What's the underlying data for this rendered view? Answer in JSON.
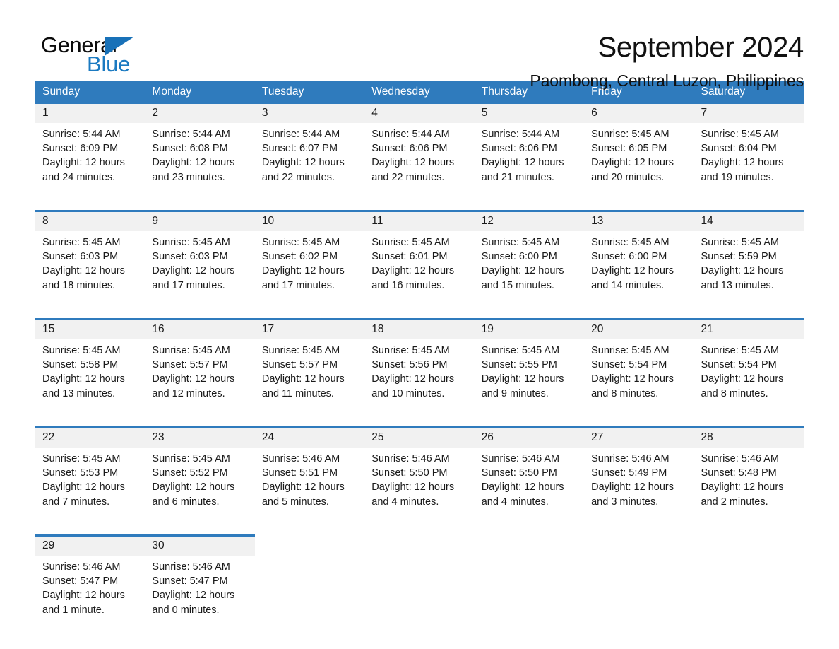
{
  "brand": {
    "name_part1": "General",
    "name_part2": "Blue",
    "triangle_color": "#1871b8",
    "blue_text_color": "#1b7ac1"
  },
  "header": {
    "month_title": "September 2024",
    "location": "Paombong, Central Luzon, Philippines"
  },
  "theme": {
    "header_blue": "#2f7bbd",
    "daynum_band": "#f1f1f1",
    "text": "#1a1a1a"
  },
  "weekday_headers": [
    "Sunday",
    "Monday",
    "Tuesday",
    "Wednesday",
    "Thursday",
    "Friday",
    "Saturday"
  ],
  "weeks": [
    [
      {
        "day": "1",
        "lines": [
          "Sunrise: 5:44 AM",
          "Sunset: 6:09 PM",
          "Daylight: 12 hours",
          "and 24 minutes."
        ]
      },
      {
        "day": "2",
        "lines": [
          "Sunrise: 5:44 AM",
          "Sunset: 6:08 PM",
          "Daylight: 12 hours",
          "and 23 minutes."
        ]
      },
      {
        "day": "3",
        "lines": [
          "Sunrise: 5:44 AM",
          "Sunset: 6:07 PM",
          "Daylight: 12 hours",
          "and 22 minutes."
        ]
      },
      {
        "day": "4",
        "lines": [
          "Sunrise: 5:44 AM",
          "Sunset: 6:06 PM",
          "Daylight: 12 hours",
          "and 22 minutes."
        ]
      },
      {
        "day": "5",
        "lines": [
          "Sunrise: 5:44 AM",
          "Sunset: 6:06 PM",
          "Daylight: 12 hours",
          "and 21 minutes."
        ]
      },
      {
        "day": "6",
        "lines": [
          "Sunrise: 5:45 AM",
          "Sunset: 6:05 PM",
          "Daylight: 12 hours",
          "and 20 minutes."
        ]
      },
      {
        "day": "7",
        "lines": [
          "Sunrise: 5:45 AM",
          "Sunset: 6:04 PM",
          "Daylight: 12 hours",
          "and 19 minutes."
        ]
      }
    ],
    [
      {
        "day": "8",
        "lines": [
          "Sunrise: 5:45 AM",
          "Sunset: 6:03 PM",
          "Daylight: 12 hours",
          "and 18 minutes."
        ]
      },
      {
        "day": "9",
        "lines": [
          "Sunrise: 5:45 AM",
          "Sunset: 6:03 PM",
          "Daylight: 12 hours",
          "and 17 minutes."
        ]
      },
      {
        "day": "10",
        "lines": [
          "Sunrise: 5:45 AM",
          "Sunset: 6:02 PM",
          "Daylight: 12 hours",
          "and 17 minutes."
        ]
      },
      {
        "day": "11",
        "lines": [
          "Sunrise: 5:45 AM",
          "Sunset: 6:01 PM",
          "Daylight: 12 hours",
          "and 16 minutes."
        ]
      },
      {
        "day": "12",
        "lines": [
          "Sunrise: 5:45 AM",
          "Sunset: 6:00 PM",
          "Daylight: 12 hours",
          "and 15 minutes."
        ]
      },
      {
        "day": "13",
        "lines": [
          "Sunrise: 5:45 AM",
          "Sunset: 6:00 PM",
          "Daylight: 12 hours",
          "and 14 minutes."
        ]
      },
      {
        "day": "14",
        "lines": [
          "Sunrise: 5:45 AM",
          "Sunset: 5:59 PM",
          "Daylight: 12 hours",
          "and 13 minutes."
        ]
      }
    ],
    [
      {
        "day": "15",
        "lines": [
          "Sunrise: 5:45 AM",
          "Sunset: 5:58 PM",
          "Daylight: 12 hours",
          "and 13 minutes."
        ]
      },
      {
        "day": "16",
        "lines": [
          "Sunrise: 5:45 AM",
          "Sunset: 5:57 PM",
          "Daylight: 12 hours",
          "and 12 minutes."
        ]
      },
      {
        "day": "17",
        "lines": [
          "Sunrise: 5:45 AM",
          "Sunset: 5:57 PM",
          "Daylight: 12 hours",
          "and 11 minutes."
        ]
      },
      {
        "day": "18",
        "lines": [
          "Sunrise: 5:45 AM",
          "Sunset: 5:56 PM",
          "Daylight: 12 hours",
          "and 10 minutes."
        ]
      },
      {
        "day": "19",
        "lines": [
          "Sunrise: 5:45 AM",
          "Sunset: 5:55 PM",
          "Daylight: 12 hours",
          "and 9 minutes."
        ]
      },
      {
        "day": "20",
        "lines": [
          "Sunrise: 5:45 AM",
          "Sunset: 5:54 PM",
          "Daylight: 12 hours",
          "and 8 minutes."
        ]
      },
      {
        "day": "21",
        "lines": [
          "Sunrise: 5:45 AM",
          "Sunset: 5:54 PM",
          "Daylight: 12 hours",
          "and 8 minutes."
        ]
      }
    ],
    [
      {
        "day": "22",
        "lines": [
          "Sunrise: 5:45 AM",
          "Sunset: 5:53 PM",
          "Daylight: 12 hours",
          "and 7 minutes."
        ]
      },
      {
        "day": "23",
        "lines": [
          "Sunrise: 5:45 AM",
          "Sunset: 5:52 PM",
          "Daylight: 12 hours",
          "and 6 minutes."
        ]
      },
      {
        "day": "24",
        "lines": [
          "Sunrise: 5:46 AM",
          "Sunset: 5:51 PM",
          "Daylight: 12 hours",
          "and 5 minutes."
        ]
      },
      {
        "day": "25",
        "lines": [
          "Sunrise: 5:46 AM",
          "Sunset: 5:50 PM",
          "Daylight: 12 hours",
          "and 4 minutes."
        ]
      },
      {
        "day": "26",
        "lines": [
          "Sunrise: 5:46 AM",
          "Sunset: 5:50 PM",
          "Daylight: 12 hours",
          "and 4 minutes."
        ]
      },
      {
        "day": "27",
        "lines": [
          "Sunrise: 5:46 AM",
          "Sunset: 5:49 PM",
          "Daylight: 12 hours",
          "and 3 minutes."
        ]
      },
      {
        "day": "28",
        "lines": [
          "Sunrise: 5:46 AM",
          "Sunset: 5:48 PM",
          "Daylight: 12 hours",
          "and 2 minutes."
        ]
      }
    ],
    [
      {
        "day": "29",
        "lines": [
          "Sunrise: 5:46 AM",
          "Sunset: 5:47 PM",
          "Daylight: 12 hours",
          "and 1 minute."
        ]
      },
      {
        "day": "30",
        "lines": [
          "Sunrise: 5:46 AM",
          "Sunset: 5:47 PM",
          "Daylight: 12 hours",
          "and 0 minutes."
        ]
      },
      {
        "day": "",
        "lines": []
      },
      {
        "day": "",
        "lines": []
      },
      {
        "day": "",
        "lines": []
      },
      {
        "day": "",
        "lines": []
      },
      {
        "day": "",
        "lines": []
      }
    ]
  ]
}
